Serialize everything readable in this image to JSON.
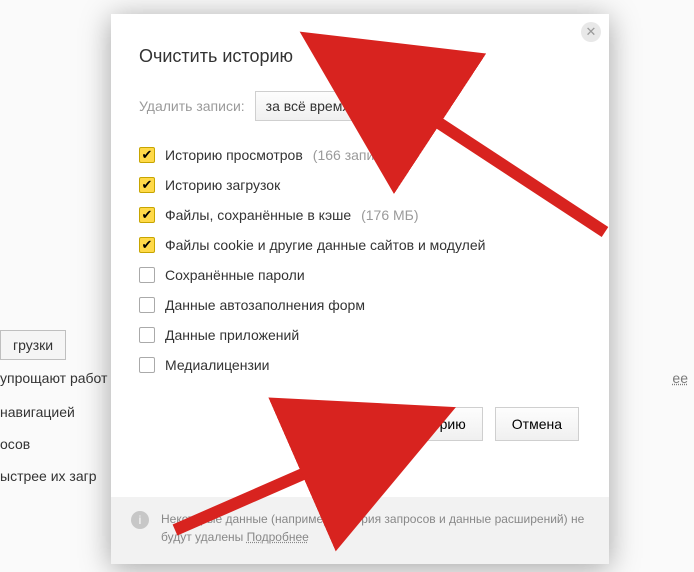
{
  "bg": {
    "btn1": "грузки",
    "text1": "упрощают работ",
    "text2": "навигацией",
    "text3": "осов",
    "text4": "ыстрее их загр",
    "link": "ее"
  },
  "modal": {
    "title": "Очистить историю",
    "delete_label": "Удалить записи:",
    "select_value": "за всё время",
    "checks": [
      {
        "label": "Историю просмотров",
        "note": "(166 записей)",
        "checked": true
      },
      {
        "label": "Историю загрузок",
        "note": "",
        "checked": true
      },
      {
        "label": "Файлы, сохранённые в кэше",
        "note": "(176 МБ)",
        "checked": true
      },
      {
        "label": "Файлы cookie и другие данные сайтов и модулей",
        "note": "",
        "checked": true
      },
      {
        "label": "Сохранённые пароли",
        "note": "",
        "checked": false
      },
      {
        "label": "Данные автозаполнения форм",
        "note": "",
        "checked": false
      },
      {
        "label": "Данные приложений",
        "note": "",
        "checked": false
      },
      {
        "label": "Медиалицензии",
        "note": "",
        "checked": false
      }
    ],
    "clear_btn": "Очистить историю",
    "cancel_btn": "Отмена",
    "footer_text": "Некоторые данные (например, история запросов и данные расширений) не будут удалены ",
    "footer_link": "Подробнее"
  }
}
